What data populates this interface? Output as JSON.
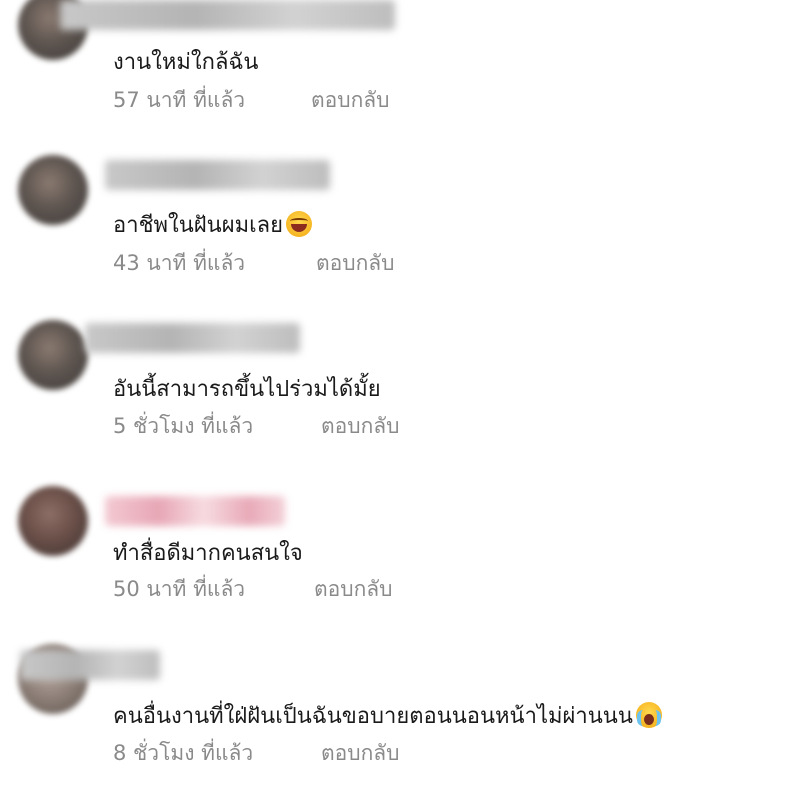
{
  "comments": [
    {
      "text": "งานใหม่ใกล้ฉัน",
      "time": "57 นาที ที่แล้ว",
      "reply_label": "ตอบกลับ",
      "emoji": ""
    },
    {
      "text": "อาชีพในฝันผมเลย",
      "time": "43 นาที ที่แล้ว",
      "reply_label": "ตอบกลับ",
      "emoji": "laughing-face-icon"
    },
    {
      "text": "อันนี้สามารถขึ้นไปร่วมได้มั้ย",
      "time": "5 ชั่วโมง ที่แล้ว",
      "reply_label": "ตอบกลับ",
      "emoji": ""
    },
    {
      "text": "ทำสื่อดีมากคนสนใจ",
      "time": "50 นาที ที่แล้ว",
      "reply_label": "ตอบกลับ",
      "emoji": ""
    },
    {
      "text": "คนอื่นงานที่ใฝ่ฝันเป็นฉันขอบายตอนนอนหน้าไม่ผ่านนน",
      "time": "8 ชั่วโมง ที่แล้ว",
      "reply_label": "ตอบกลับ",
      "emoji": "crying-face-icon"
    }
  ]
}
